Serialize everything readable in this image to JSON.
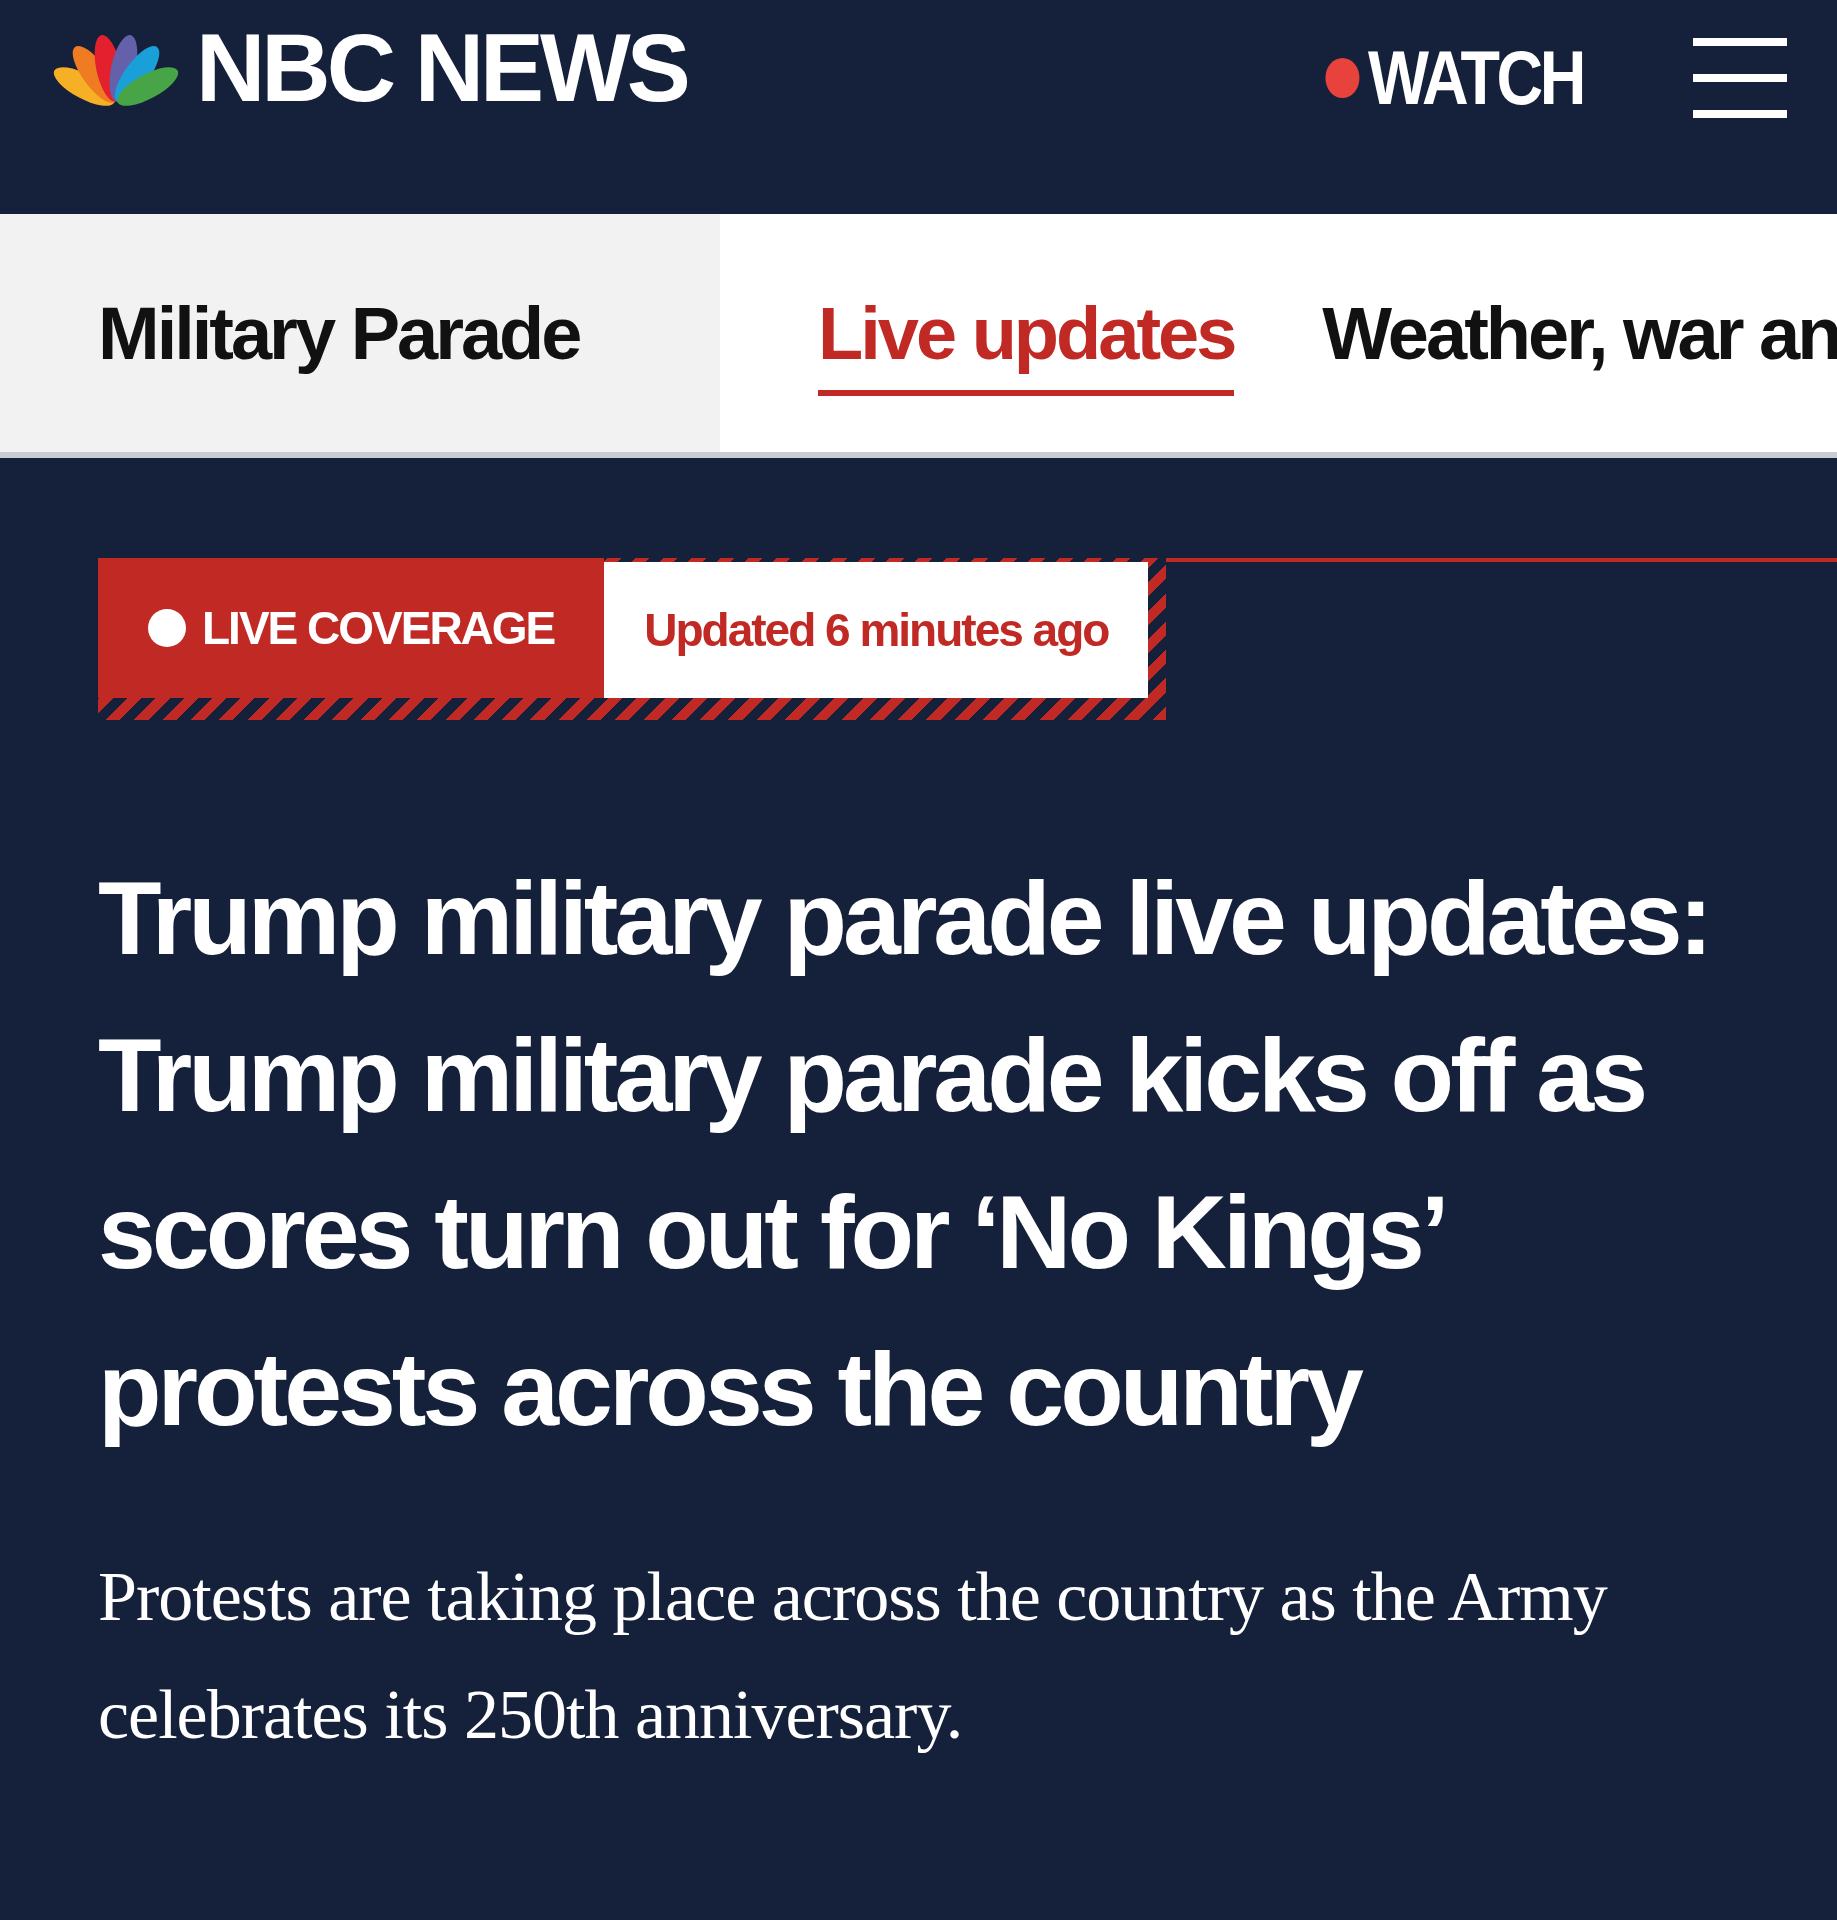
{
  "header": {
    "logo_text": "NBC NEWS",
    "watch": {
      "label": "WATCH",
      "live": true
    }
  },
  "nav": {
    "section": "Military Parade",
    "tabs": [
      {
        "label": "Live updates",
        "selected": true
      },
      {
        "label": "Weather, war an",
        "selected": false
      }
    ]
  },
  "badge": {
    "live_label": "LIVE COVERAGE",
    "updated": "Updated 6 minutes ago"
  },
  "headline": "Trump military parade live updates: Trump military parade kicks off as scores turn out for ‘No Kings’ protests across the country",
  "lede": "Protests are taking place across the country as the Army celebrates its 250th anniversary."
}
